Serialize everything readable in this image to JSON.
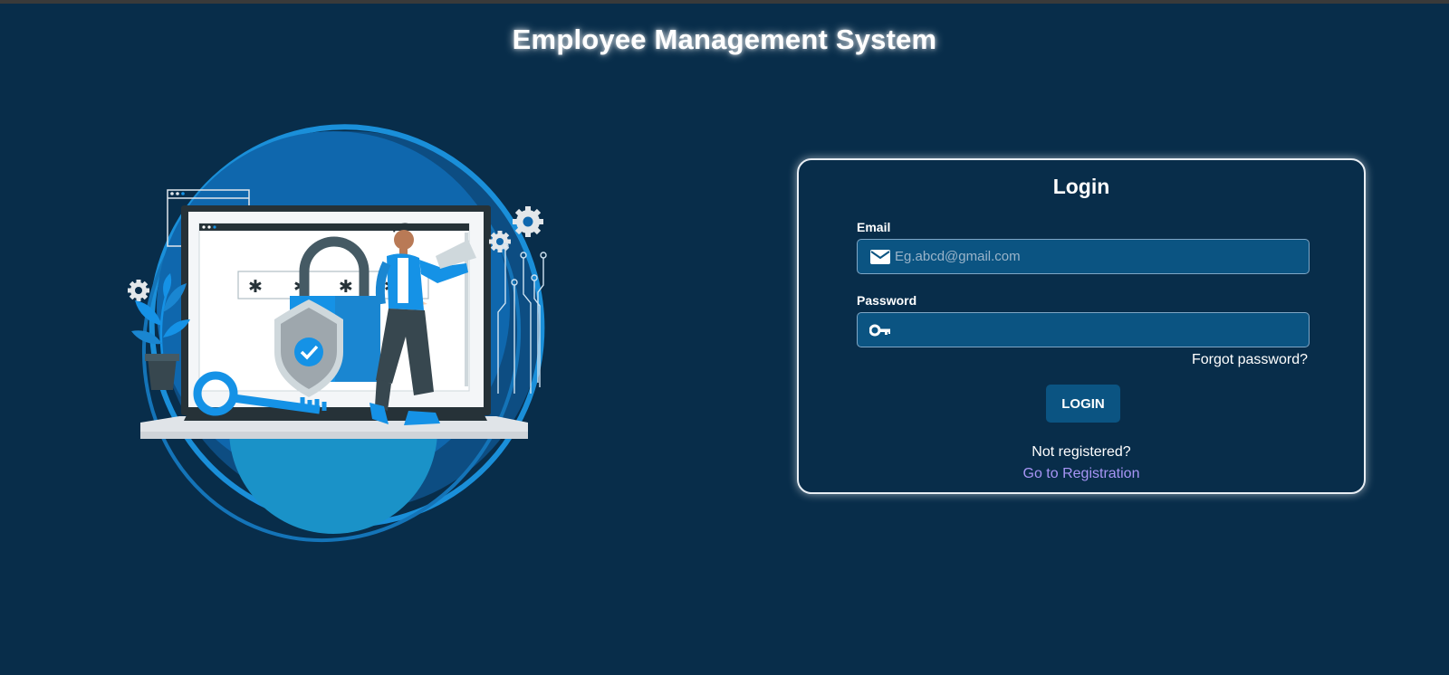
{
  "page": {
    "title": "Employee Management System"
  },
  "illustration": {
    "password_mask": "✱ ✱ ✱ ✱"
  },
  "login": {
    "title": "Login",
    "email_label": "Email",
    "email_placeholder": "Eg.abcd@gmail.com",
    "email_value": "",
    "password_label": "Password",
    "password_value": "",
    "forgot_password": "Forgot password?",
    "login_button": "LOGIN",
    "not_registered": "Not registered?",
    "register_link": "Go to Registration",
    "email_icon": "envelope-icon",
    "password_icon": "key-icon"
  },
  "colors": {
    "background": "#082d4a",
    "field_background": "#0b5482",
    "link": "#a795f5",
    "accent_blue": "#1592e6"
  }
}
